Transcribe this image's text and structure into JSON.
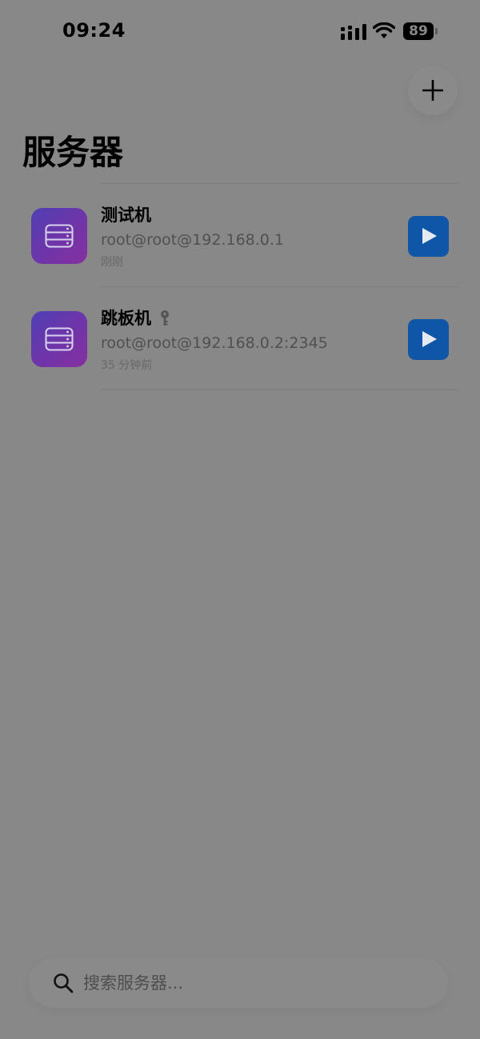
{
  "status_bar": {
    "time": "09:24",
    "battery": "89",
    "icons": [
      "signal-icon",
      "wifi-icon",
      "battery-icon"
    ]
  },
  "header": {
    "title": "服务器",
    "add_icon": "plus-icon"
  },
  "servers": [
    {
      "name": "测试机",
      "address": "root@root@192.168.0.1",
      "last_seen": "刚刚",
      "has_key": false,
      "icon": "server-icon"
    },
    {
      "name": "跳板机",
      "address": "root@root@192.168.0.2:2345",
      "last_seen": "35 分钟前",
      "has_key": true,
      "icon": "server-icon"
    }
  ],
  "search": {
    "placeholder": "搜索服务器...",
    "value": "",
    "icon": "search-icon"
  },
  "colors": {
    "background": "#888888",
    "connect_button": "#0f57a6",
    "avatar_gradient_start": "#4f3fb3",
    "avatar_gradient_end": "#86309f"
  }
}
